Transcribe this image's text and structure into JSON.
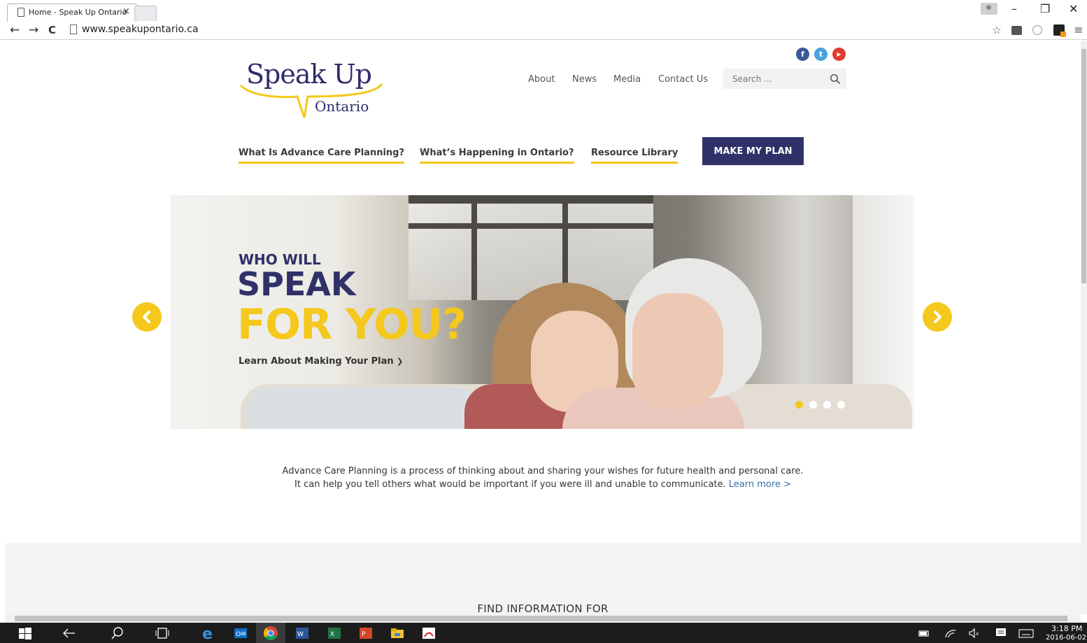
{
  "browser": {
    "tab_title": "Home - Speak Up Ontario",
    "tab_close": "×",
    "url": "www.speakupontario.ca",
    "back": "←",
    "forward": "→",
    "reload": "C",
    "minimize": "–",
    "restore": "❐",
    "close": "✕",
    "star": "☆",
    "menu": "≡"
  },
  "site": {
    "logo": {
      "line1": "Speak Up",
      "line2": "Ontario"
    },
    "social": [
      {
        "name": "facebook",
        "glyph": "f",
        "color": "#3b5998"
      },
      {
        "name": "twitter",
        "glyph": "t",
        "color": "#4aa3e0"
      },
      {
        "name": "youtube",
        "glyph": "▶",
        "color": "#e03a2b"
      }
    ],
    "topnav": [
      "About",
      "News",
      "Media",
      "Contact Us"
    ],
    "search_placeholder": "Search ...",
    "mainnav": [
      "What Is Advance Care Planning?",
      "What’s Happening in Ontario?",
      "Resource Library"
    ],
    "cta": "MAKE MY PLAN",
    "hero": {
      "line1": "WHO WILL",
      "line2": "SPEAK",
      "line3": "FOR YOU?",
      "link": "Learn About Making Your Plan",
      "link_arrow": "❯",
      "slide_count": 4,
      "active_slide": 1
    },
    "intro": {
      "line1": "Advance Care Planning is a process of thinking about and sharing your wishes for future health and personal care.",
      "line2": "It can help you tell others what would be important if you were ill and unable to communicate.",
      "learn_more": "Learn more >"
    },
    "find_title": "FIND INFORMATION FOR"
  },
  "taskbar": {
    "time": "3:18 PM",
    "date": "2016-06-02"
  },
  "colors": {
    "navy": "#2f3168",
    "yellow": "#f4c81c",
    "link": "#3a6fa8"
  }
}
